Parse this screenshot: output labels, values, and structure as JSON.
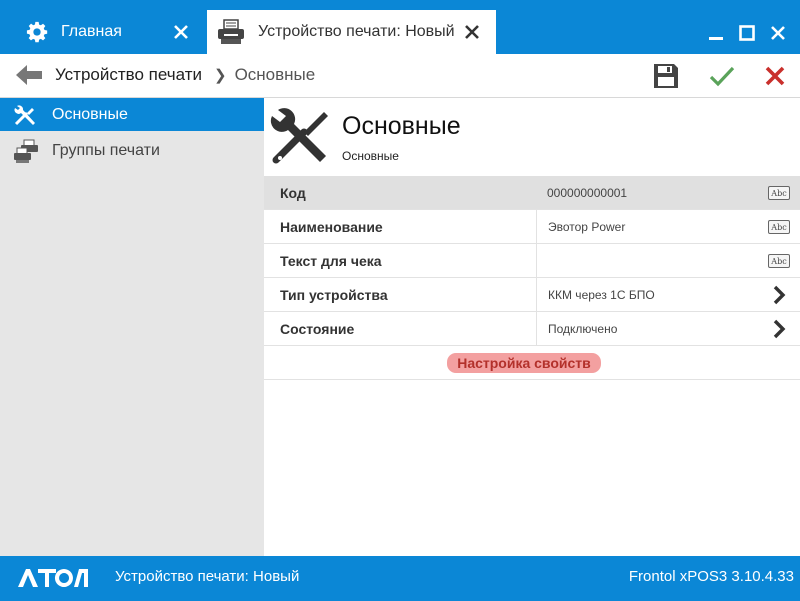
{
  "tabs": [
    {
      "label": "Главная",
      "icon": "gear-icon"
    },
    {
      "label": "Устройство печати: Новый",
      "icon": "printer-icon"
    }
  ],
  "breadcrumb": {
    "items": [
      "Устройство печати",
      "Основные"
    ]
  },
  "sidebar": {
    "items": [
      {
        "label": "Основные",
        "icon": "tools-icon",
        "active": true
      },
      {
        "label": "Группы печати",
        "icon": "printer-group-icon",
        "active": false
      }
    ]
  },
  "page": {
    "title": "Основные",
    "subtitle": "Основные"
  },
  "properties": [
    {
      "label": "Код",
      "value": "000000000001",
      "action": "text-edit-icon"
    },
    {
      "label": "Наименование",
      "value": "Эвотор Power",
      "action": "text-edit-icon"
    },
    {
      "label": "Текст для чека",
      "value": "",
      "action": "text-edit-icon"
    },
    {
      "label": "Тип устройства",
      "value": "ККМ через 1С БПО",
      "action": "chevron-right-icon"
    },
    {
      "label": "Состояние",
      "value": "Подключено",
      "action": "chevron-right-icon"
    }
  ],
  "abc_label": "Abc",
  "settings_link": "Настройка свойств",
  "statusbar": {
    "left": "Устройство печати: Новый",
    "right": "Frontol xPOS3 3.10.4.33",
    "logo": "АТОЛ"
  },
  "colors": {
    "accent": "#0b87d6",
    "sidebar_bg": "#e6e6e6",
    "save_icon": "#444444",
    "confirm_icon": "#5aa35a",
    "cancel_icon": "#c9302c",
    "link_highlight": "#f3a0a0",
    "link_text": "#b3312b"
  }
}
